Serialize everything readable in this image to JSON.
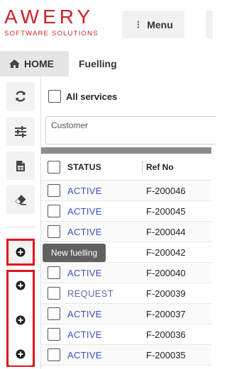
{
  "header": {
    "logo_word": "AWERY",
    "logo_sub": "SOFTWARE SOLUTIONS",
    "menu_label": "Menu"
  },
  "tabs": {
    "home_label": "HOME",
    "active_label": "Fuelling"
  },
  "toolbar": {
    "tooltip": "New fuelling",
    "icons": [
      "refresh-icon",
      "filter-sliders-icon",
      "spreadsheet-icon",
      "eraser-icon",
      "add-icon",
      "add-icon",
      "add-icon",
      "add-icon"
    ]
  },
  "filters": {
    "all_services_label": "All services",
    "customer_placeholder": "Customer"
  },
  "table": {
    "headers": {
      "status": "STATUS",
      "ref": "Ref No"
    },
    "rows": [
      {
        "status": "ACTIVE",
        "ref": "F-200046"
      },
      {
        "status": "ACTIVE",
        "ref": "F-200045"
      },
      {
        "status": "ACTIVE",
        "ref": "F-200044"
      },
      {
        "status": "",
        "ref": "F-200042"
      },
      {
        "status": "ACTIVE",
        "ref": "F-200040"
      },
      {
        "status": "REQUEST",
        "ref": "F-200039"
      },
      {
        "status": "ACTIVE",
        "ref": "F-200037"
      },
      {
        "status": "ACTIVE",
        "ref": "F-200036"
      },
      {
        "status": "ACTIVE",
        "ref": "F-200035"
      }
    ]
  },
  "colors": {
    "brand_red": "#cc2229",
    "highlight_red": "#e0141e",
    "status_blue": "#3a4fc0"
  }
}
